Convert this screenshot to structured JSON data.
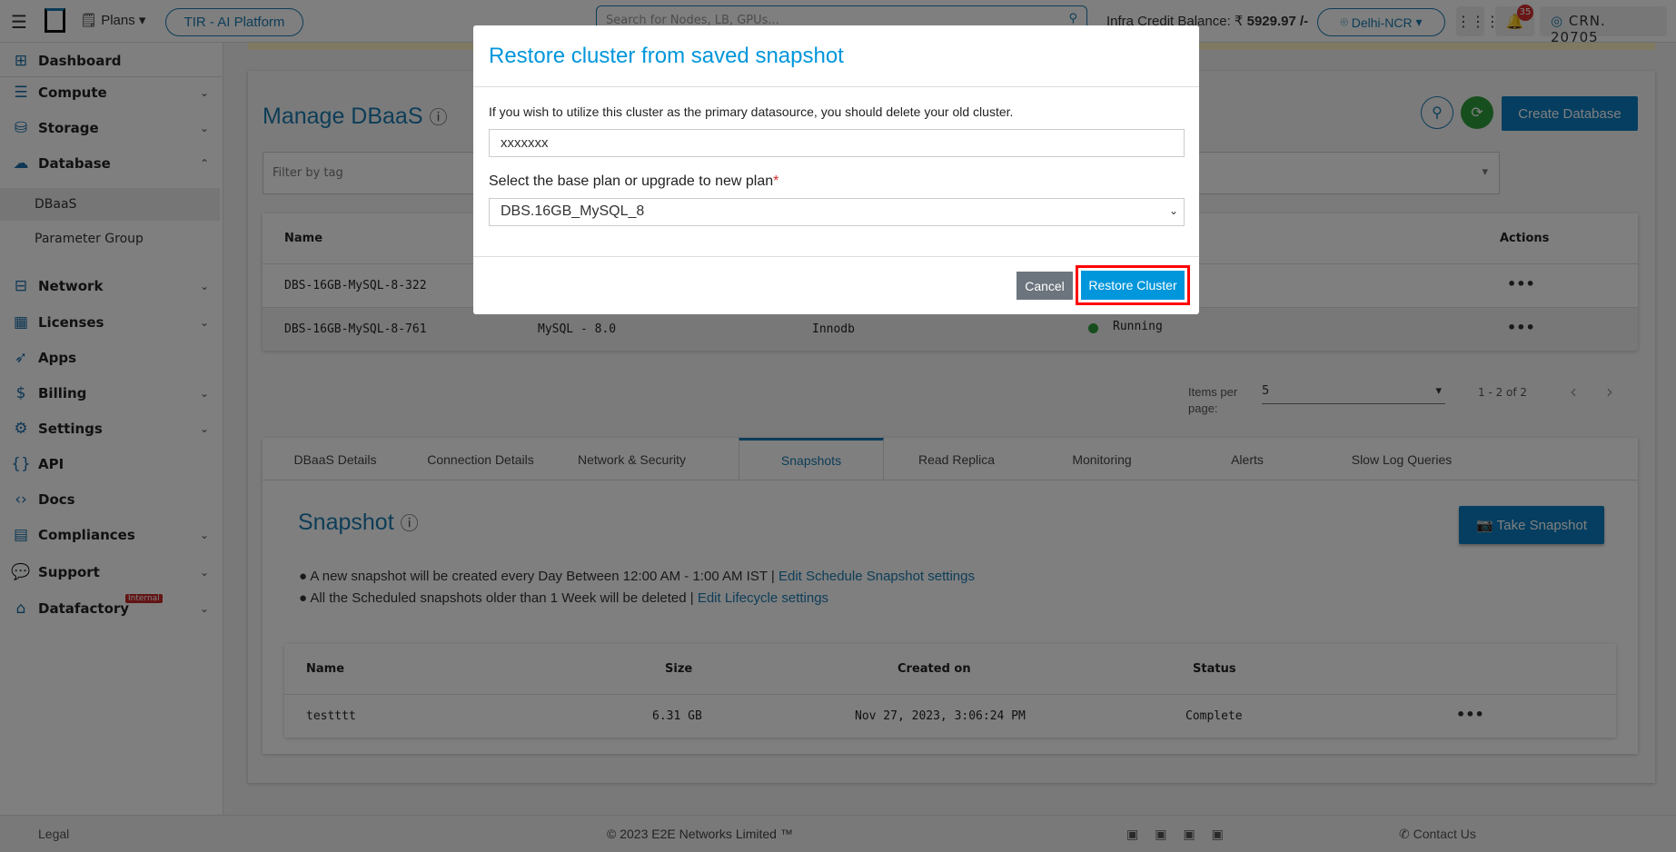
{
  "topbar": {
    "plans": "Plans",
    "platform": "TIR - AI Platform",
    "search_placeholder": "Search for Nodes, LB, GPUs...",
    "credit_label": "Infra Credit Balance: ₹",
    "credit_value": "5929.97 /-",
    "region": "Delhi-NCR",
    "notif_count": "35",
    "account": "CRN. 20705"
  },
  "sidebar": {
    "items": [
      {
        "label": "Dashboard",
        "icon": "dashboard-icon",
        "chev": ""
      },
      {
        "label": "Compute",
        "icon": "server-icon",
        "chev": "⌄"
      },
      {
        "label": "Storage",
        "icon": "database-icon",
        "chev": "⌄"
      },
      {
        "label": "Database",
        "icon": "cloud-network-icon",
        "chev": "⌃"
      },
      {
        "label": "Network",
        "icon": "network-icon",
        "chev": "⌄"
      },
      {
        "label": "Licenses",
        "icon": "grid-icon",
        "chev": "⌄"
      },
      {
        "label": "Apps",
        "icon": "rocket-icon",
        "chev": ""
      },
      {
        "label": "Billing",
        "icon": "billing-icon",
        "chev": "⌄"
      },
      {
        "label": "Settings",
        "icon": "gear-icon",
        "chev": "⌄"
      },
      {
        "label": "API",
        "icon": "braces-icon",
        "chev": ""
      },
      {
        "label": "Docs",
        "icon": "code-icon",
        "chev": ""
      },
      {
        "label": "Compliances",
        "icon": "document-icon",
        "chev": "⌄"
      },
      {
        "label": "Support",
        "icon": "support-icon",
        "chev": "⌄"
      },
      {
        "label": "Datafactory",
        "icon": "factory-icon",
        "chev": "⌄"
      }
    ],
    "sub": [
      "DBaaS",
      "Parameter Group"
    ],
    "badge": "Internal"
  },
  "main": {
    "title": "Manage DBaaS",
    "create": "Create Database",
    "filter_placeholder": "Filter by tag",
    "table": {
      "headers": [
        "Name",
        "Actions"
      ],
      "rows": [
        {
          "name": "DBS-16GB-MySQL-8-322",
          "engine": "",
          "storage": "",
          "status": ""
        },
        {
          "name": "DBS-16GB-MySQL-8-761",
          "engine": "MySQL - 8.0",
          "storage": "Innodb",
          "status": "Running"
        }
      ]
    },
    "pagination": {
      "label": "Items per page:",
      "value": "5",
      "range": "1 - 2 of 2"
    },
    "tabs": [
      "DBaaS Details",
      "Connection Details",
      "Network & Security",
      "Snapshots",
      "Read Replica",
      "Monitoring",
      "Alerts",
      "Slow Log Queries"
    ],
    "active_tab": "Snapshots",
    "snapshot": {
      "title": "Snapshot",
      "take": "Take Snapshot",
      "bullet1": "A new snapshot will be created every Day Between 12:00 AM - 1:00 AM IST |",
      "link1": "Edit Schedule Snapshot settings",
      "bullet2": "All the Scheduled snapshots older than 1 Week will be deleted |",
      "link2": "Edit Lifecycle settings",
      "headers": [
        "Name",
        "Size",
        "Created on",
        "Status"
      ],
      "rows": [
        {
          "name": "testttt",
          "size": "6.31 GB",
          "created": "Nov 27, 2023, 3:06:24 PM",
          "status": "Complete"
        }
      ]
    }
  },
  "footer": {
    "legal": "Legal",
    "copyright": "© 2023 E2E Networks Limited ™",
    "contact": "Contact Us"
  },
  "modal": {
    "title": "Restore cluster from saved snapshot",
    "info": "If you wish to utilize this cluster as the primary datasource, you should delete your old cluster.",
    "name_value": "xxxxxxx",
    "plan_label": "Select the base plan or upgrade to new plan",
    "required": "*",
    "plan_value": "DBS.16GB_MySQL_8",
    "cancel": "Cancel",
    "restore": "Restore Cluster"
  },
  "colors": {
    "accent": "#0096db",
    "brand": "#1a7bb0",
    "highlight": "#ff0000"
  }
}
